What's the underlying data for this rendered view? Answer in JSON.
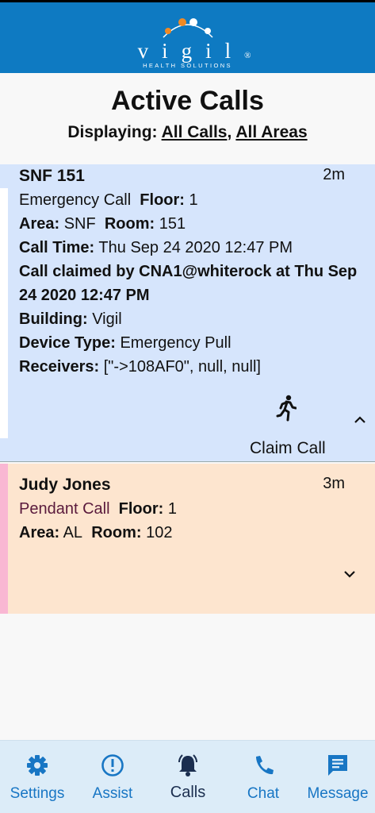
{
  "brand": {
    "name": "vigil",
    "registered": "®",
    "tagline": "HEALTH SOLUTIONS"
  },
  "page": {
    "title": "Active Calls",
    "displaying_label": "Displaying:",
    "filter_calls": "All Calls",
    "separator": ",",
    "filter_areas": "All Areas"
  },
  "calls": [
    {
      "name": "SNF 151",
      "age": "2m",
      "type": "Emergency Call",
      "floor_label": "Floor:",
      "floor": "1",
      "area_label": "Area:",
      "area": "SNF",
      "room_label": "Room:",
      "room": "151",
      "time_label": "Call Time:",
      "time": "Thu Sep 24 2020 12:47 PM",
      "claimed_text": "Call claimed by CNA1@whiterock at Thu Sep 24 2020 12:47 PM",
      "building_label": "Building:",
      "building": "Vigil",
      "device_label": "Device Type:",
      "device": "Emergency Pull",
      "receivers_label": "Receivers:",
      "receivers": "[\"->108AF0\", null, null]",
      "claim_label": "Claim Call",
      "expanded": true,
      "background": "#d6e5fc"
    },
    {
      "name": "Judy Jones",
      "age": "3m",
      "type": "Pendant Call",
      "floor_label": "Floor:",
      "floor": "1",
      "area_label": "Area:",
      "area": "AL",
      "room_label": "Room:",
      "room": "102",
      "expanded": false,
      "background": "#fde5cf"
    }
  ],
  "tabs": [
    {
      "label": "Settings",
      "icon": "gear-icon",
      "active": false
    },
    {
      "label": "Assist",
      "icon": "alert-circle-icon",
      "active": false
    },
    {
      "label": "Calls",
      "icon": "bell-icon",
      "active": true
    },
    {
      "label": "Chat",
      "icon": "phone-icon",
      "active": false
    },
    {
      "label": "Message",
      "icon": "message-icon",
      "active": false
    }
  ],
  "colors": {
    "header": "#0e7ac2",
    "tab_bar": "#dcecf8",
    "tab_icon": "#1876c4",
    "tab_active": "#1b2e4f",
    "pendant_stripe": "#f9b7d3",
    "logo_orange": "#f08a24"
  }
}
